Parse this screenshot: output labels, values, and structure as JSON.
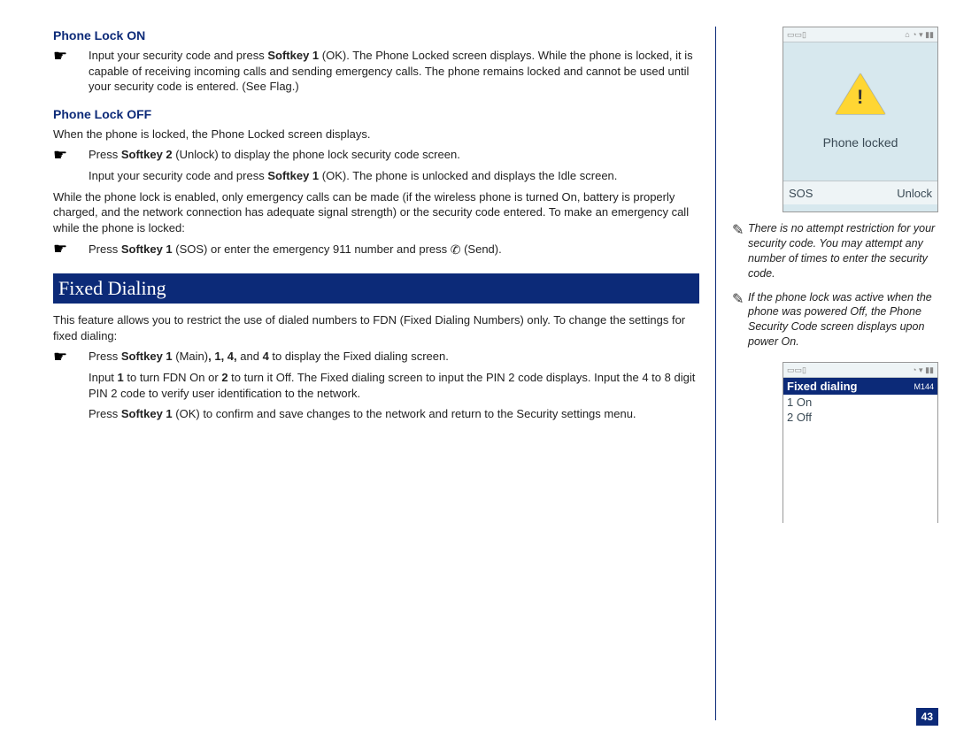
{
  "main": {
    "h1": "Phone Lock ON",
    "b1_pre": "Input your security code and press ",
    "b1_bold": "Softkey 1",
    "b1_post": " (OK). The Phone Locked screen displays. While the phone is locked, it is capable of receiving incoming calls and sending emergency calls. The phone remains locked and cannot be used until your security code is entered. (See Flag.)",
    "h2": "Phone Lock OFF",
    "p2": "When the phone is locked, the Phone Locked screen displays.",
    "b2_pre": "Press ",
    "b2_bold": "Softkey 2",
    "b2_post": " (Unlock) to display the phone lock security code screen.",
    "i2_pre": "Input your security code and press ",
    "i2_bold": "Softkey 1",
    "i2_post": " (OK). The phone is unlocked and displays the Idle screen.",
    "p3": "While the phone lock is enabled, only emergency calls can be made (if the wireless phone is turned On, battery is properly charged, and the network connection has adequate signal strength) or the security code entered. To make an emergency call while the phone is locked:",
    "b3_pre": "Press ",
    "b3_bold": "Softkey 1",
    "b3_mid": " (SOS) or enter the emergency 911 number and press ",
    "b3_post": " (Send).",
    "section_title": "Fixed Dialing",
    "p4": "This feature allows you to restrict the use of dialed numbers to FDN (Fixed Dialing Numbers) only. To change the settings for fixed dialing:",
    "b4_pre": "Press ",
    "b4_bold1": "Softkey 1",
    "b4_mid1": " (Main)",
    "b4_bold2": ", 1, 4,",
    "b4_mid2": " and ",
    "b4_bold3": "4",
    "b4_post": " to display the Fixed dialing screen.",
    "i4_pre": "Input ",
    "i4_b1": "1",
    "i4_mid1": " to turn FDN On or ",
    "i4_b2": "2",
    "i4_post": " to turn it Off. The Fixed dialing screen to input the PIN 2 code displays. Input the 4 to 8 digit PIN 2 code to verify user identification to the network.",
    "i5_pre": "Press ",
    "i5_bold": "Softkey 1",
    "i5_post": " (OK) to confirm and save changes to the network and return to the Security settings menu."
  },
  "side": {
    "phone1": {
      "body_label": "Phone locked",
      "sk_left": "SOS",
      "sk_right": "Unlock"
    },
    "note1": "There is no attempt restriction for your security code. You may attempt any number of times to enter the security code.",
    "note2": "If the phone lock was active when the phone was powered Off, the Phone Security Code screen displays upon power On.",
    "phone2": {
      "title": "Fixed dialing",
      "mref": "M144",
      "item1_num": "1",
      "item1_label": "On",
      "item2_num": "2",
      "item2_label": "Off"
    },
    "page_num": "43"
  }
}
